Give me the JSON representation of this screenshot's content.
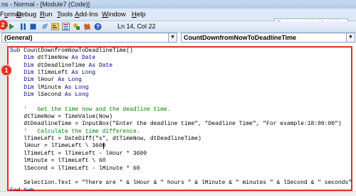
{
  "window": {
    "title": "ns - Normal - [Module7 (Code)]"
  },
  "menu": {
    "items": [
      {
        "label": "Format",
        "underline": "o"
      },
      {
        "label": "Debug",
        "underline": "D"
      },
      {
        "label": "Run",
        "underline": "R"
      },
      {
        "label": "Tools",
        "underline": "T"
      },
      {
        "label": "Add-Ins",
        "underline": "A"
      },
      {
        "label": "Window",
        "underline": "W"
      },
      {
        "label": "Help",
        "underline": "H"
      }
    ],
    "help_placeholder": "Type a question for help"
  },
  "toolbar": {
    "icons": [
      "run-icon",
      "pause-icon",
      "reset-icon",
      "design-mode-icon",
      "project-explorer-icon",
      "properties-icon",
      "object-browser-icon",
      "toolbox-icon",
      "help-icon"
    ],
    "position": "Ln 14, Col 22"
  },
  "dropdowns": {
    "object": "(General)",
    "procedure": "CountDownfromNowToDeadlineTime"
  },
  "badges": {
    "run": "2",
    "code": "1"
  },
  "code": {
    "lines": [
      [
        {
          "t": "Sub ",
          "c": "kw"
        },
        {
          "t": "CountDownfromNowToDeadlineTime()",
          "c": ""
        }
      ],
      [
        {
          "t": "    Dim ",
          "c": "kw"
        },
        {
          "t": "dtTimeNow ",
          "c": ""
        },
        {
          "t": "As Date",
          "c": "kw"
        }
      ],
      [
        {
          "t": "    Dim ",
          "c": "kw"
        },
        {
          "t": "dtDeadlineTime ",
          "c": ""
        },
        {
          "t": "As Date",
          "c": "kw"
        }
      ],
      [
        {
          "t": "    Dim ",
          "c": "kw"
        },
        {
          "t": "lTimeLeft ",
          "c": ""
        },
        {
          "t": "As Long",
          "c": "kw"
        }
      ],
      [
        {
          "t": "    Dim ",
          "c": "kw"
        },
        {
          "t": "lHour ",
          "c": ""
        },
        {
          "t": "As Long",
          "c": "kw"
        }
      ],
      [
        {
          "t": "    Dim ",
          "c": "kw"
        },
        {
          "t": "lMinute ",
          "c": ""
        },
        {
          "t": "As Long",
          "c": "kw"
        }
      ],
      [
        {
          "t": "    Dim ",
          "c": "kw"
        },
        {
          "t": "lSecond ",
          "c": ""
        },
        {
          "t": "As Long",
          "c": "kw"
        }
      ],
      [
        {
          "t": "",
          "c": ""
        }
      ],
      [
        {
          "t": "    '   Get the time now and the deadline time.",
          "c": "cm"
        }
      ],
      [
        {
          "t": "    dtTimeNow = TimeValue(Now)",
          "c": ""
        }
      ],
      [
        {
          "t": "    dtDeadlineTime = InputBox(\"Enter the deadline time\", \"Deadline Time\", \"For example:18:00:00\")",
          "c": ""
        }
      ],
      [
        {
          "t": "    '   Calculate the time difference.",
          "c": "cm"
        }
      ],
      [
        {
          "t": "    lTimeLeft = DateDiff(\"s\", dtTimeNow, dtDeadlineTime)",
          "c": ""
        }
      ],
      [
        {
          "t": "    lHour = lTimeLeft \\ 3600",
          "c": ""
        }
      ],
      [
        {
          "t": "    lTimeLeft = lTimeLeft - lHour * 3600",
          "c": ""
        }
      ],
      [
        {
          "t": "    lMinute = lTimeLeft \\ 60",
          "c": ""
        }
      ],
      [
        {
          "t": "    lSecond = lTimeLeft - lMinute * 60",
          "c": ""
        }
      ],
      [
        {
          "t": "",
          "c": ""
        }
      ],
      [
        {
          "t": "    Selection.Text = \"There are \" & lHour & \" hours \" & lMinute & \" minutes \" & lSecond & \" seconds\"",
          "c": ""
        }
      ],
      [
        {
          "t": "End Sub",
          "c": "kw"
        }
      ]
    ]
  }
}
